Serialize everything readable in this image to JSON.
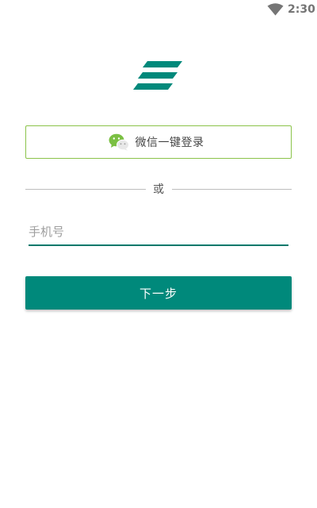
{
  "status_bar": {
    "time": "2:30",
    "icons": [
      "wifi-icon"
    ]
  },
  "logo": {
    "icon": "app-logo-icon",
    "color": "#00897b"
  },
  "wechat_login": {
    "icon": "wechat-icon",
    "label": "微信一键登录",
    "border_color": "#8bc34a"
  },
  "divider": {
    "text": "或"
  },
  "phone_field": {
    "value": "",
    "placeholder": "手机号",
    "underline_color": "#00796b"
  },
  "next_button": {
    "label": "下一步",
    "color": "#00897b"
  }
}
